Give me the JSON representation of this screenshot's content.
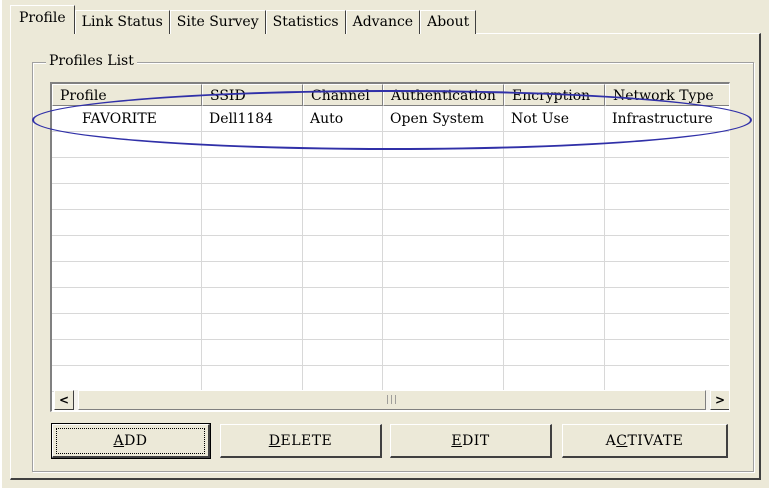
{
  "tabs": [
    {
      "label": "Profile"
    },
    {
      "label": "Link Status"
    },
    {
      "label": "Site Survey"
    },
    {
      "label": "Statistics"
    },
    {
      "label": "Advance"
    },
    {
      "label": "About"
    }
  ],
  "group": {
    "label": "Profiles List"
  },
  "table": {
    "columns": [
      "Profile",
      "SSID",
      "Channel",
      "Authentication",
      "Encryption",
      "Network Type"
    ],
    "rows": [
      [
        "FAVORITE",
        "Dell1184",
        "Auto",
        "Open System",
        "Not Use",
        "Infrastructure"
      ]
    ]
  },
  "scrollbar": {
    "left_arrow": "<",
    "right_arrow": ">",
    "thumb_grip": "|||"
  },
  "buttons": {
    "add": "ADD",
    "delete": "DELETE",
    "edit": "EDIT",
    "activate": "ACTIVATE"
  },
  "colors": {
    "highlight": "#3030a8",
    "background": "#ece9d8"
  }
}
